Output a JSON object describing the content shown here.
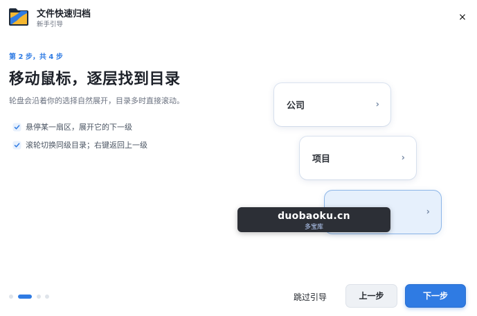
{
  "header": {
    "title": "文件快速归档",
    "subtitle": "新手引导",
    "logo_icon": "folder-icon",
    "close_label": "×"
  },
  "step": {
    "indicator": "第 2 步，共 4 步",
    "current": 2,
    "total": 4
  },
  "content": {
    "headline": "移动鼠标，逐层找到目录",
    "description": "轮盘会沿着你的选择自然展开，目录多时直接滚动。",
    "bullets": [
      {
        "text": "悬停某一扇区，展开它的下一级",
        "icon": "check-icon"
      },
      {
        "text": "滚轮切换同级目录；右键返回上一级",
        "icon": "check-icon"
      }
    ]
  },
  "illustration": {
    "cards": [
      {
        "label": "公司",
        "chevron": "›"
      },
      {
        "label": "项目",
        "chevron": "›"
      },
      {
        "label": "",
        "chevron": "›"
      }
    ]
  },
  "overlay": {
    "title": "duobaoku.cn",
    "subtitle": "多宝库"
  },
  "footer": {
    "skip_label": "跳过引导",
    "prev_label": "上一步",
    "next_label": "下一步"
  },
  "colors": {
    "accent": "#2f7be3",
    "highlight_card": "#e6f0fc"
  }
}
